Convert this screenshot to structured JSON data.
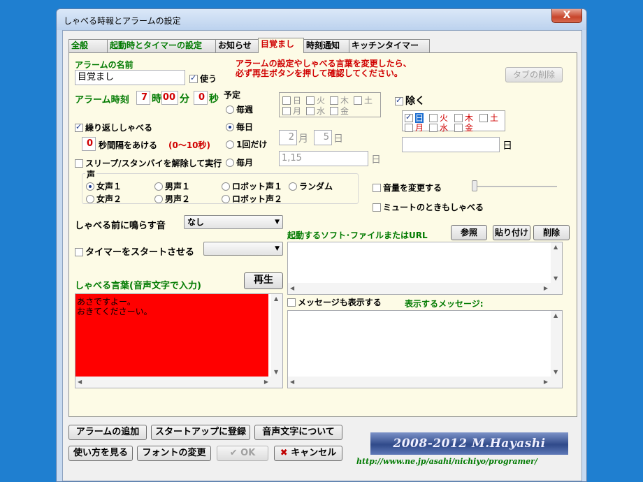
{
  "window": {
    "title": "しゃべる時報とアラームの設定",
    "close": "X"
  },
  "tabs": [
    "全般",
    "起動時とタイマーの設定",
    "お知らせ",
    "目覚まし",
    "時刻通知",
    "キッチンタイマー"
  ],
  "alarm": {
    "name_label": "アラームの名前",
    "name_value": "目覚まし",
    "use_label": "使う",
    "notice": [
      "アラームの設定やしゃべる言葉を変更したら、",
      "必ず再生ボタンを押して確認してください。"
    ],
    "delete_tab": "タブの削除",
    "time_label": "アラーム時刻",
    "hour": "7",
    "hour_unit": "時",
    "minute": "00",
    "minute_unit": "分",
    "second": "0",
    "second_unit": "秒"
  },
  "schedule": {
    "legend": "予定",
    "options": [
      "毎週",
      "毎日",
      "1回だけ",
      "毎月"
    ],
    "weekdays_row1": [
      "日",
      "火",
      "木",
      "土"
    ],
    "weekdays_row2": [
      "月",
      "水",
      "金"
    ],
    "once_month": "2",
    "once_month_unit": "月",
    "once_day": "5",
    "once_day_unit": "日",
    "monthly_value": "1,15",
    "monthly_unit": "日"
  },
  "exclude": {
    "label": "除く",
    "row1": [
      "日",
      "火",
      "木",
      "土"
    ],
    "row2": [
      "月",
      "水",
      "金"
    ],
    "day_unit": "日"
  },
  "repeat": {
    "label": "繰り返ししゃべる",
    "interval": "0",
    "interval_label": "秒間隔をあける",
    "interval_range": "(0～10秒)"
  },
  "sleep_label": "スリープ/スタンバイを解除して実行",
  "voice": {
    "legend": "声",
    "options": [
      "女声１",
      "男声１",
      "ロボット声１",
      "ランダム",
      "女声２",
      "男声２",
      "ロボット声２"
    ]
  },
  "volume_label": "音量を変更する",
  "mute_label": "ミュートのときもしゃべる",
  "pre_sound": {
    "label": "しゃべる前に鳴らす音",
    "value": "なし"
  },
  "launch": {
    "label": "起動するソフト･ファイルまたはURL",
    "browse": "参照",
    "paste": "貼り付け",
    "delete": "削除"
  },
  "timer_start_label": "タイマーをスタートさせる",
  "speech": {
    "label": "しゃべる言葉(音声文字で入力)",
    "play": "再生",
    "text": [
      "あさですよー。",
      "おきてくださーい。"
    ]
  },
  "message": {
    "show_label": "メッセージも表示する",
    "display_label": "表示するメッセージ:"
  },
  "buttons": {
    "add_alarm": "アラームの追加",
    "startup": "スタートアップに登録",
    "voice_chars": "音声文字について",
    "howto": "使い方を見る",
    "font": "フォントの変更",
    "ok": "OK",
    "cancel": "キャンセル"
  },
  "banner": "2008-2012 M.Hayashi",
  "url": "http://www.ne.jp/asahi/nichiyo/programer/",
  "colors": {
    "accent_red": "#d00000",
    "label_green": "#007a00",
    "speech_bg": "#ff0000",
    "panel_bg": "#fdfbe6"
  }
}
